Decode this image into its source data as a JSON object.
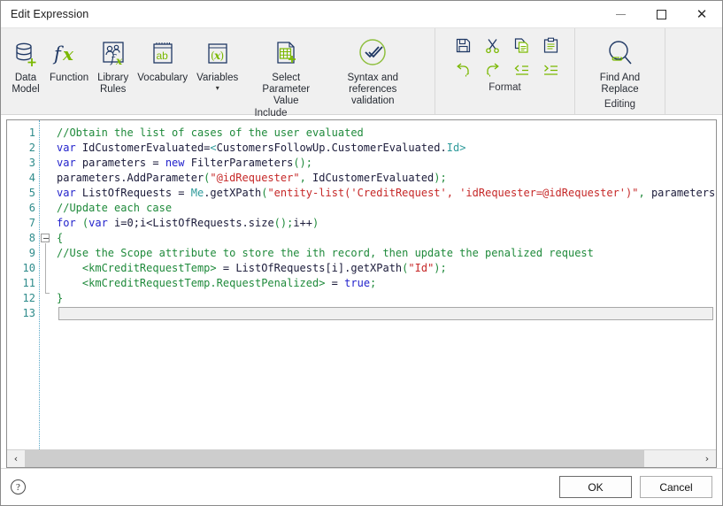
{
  "window": {
    "title": "Edit Expression",
    "controls": {
      "minimize": "–",
      "maximize": "□",
      "close": "✕"
    }
  },
  "ribbon": {
    "groups": [
      {
        "name": "include",
        "label": "Include",
        "items": [
          {
            "id": "data-model",
            "label": "Data\nModel",
            "icon": "database-plus-icon"
          },
          {
            "id": "function",
            "label": "Function",
            "icon": "fx-icon"
          },
          {
            "id": "library-rules",
            "label": "Library\nRules",
            "icon": "people-fx-icon"
          },
          {
            "id": "vocabulary",
            "label": "Vocabulary",
            "icon": "ab-notepad-icon"
          },
          {
            "id": "variables",
            "label": "Variables",
            "icon": "variable-x-icon",
            "caret": "▾"
          },
          {
            "id": "select-parameter",
            "label": "Select Parameter\nValue",
            "icon": "table-plus-icon"
          },
          {
            "id": "syntax-validation",
            "label": "Syntax and references\nvalidation",
            "icon": "check-circle-icon"
          }
        ]
      },
      {
        "name": "format",
        "label": "Format",
        "items": [
          {
            "id": "save",
            "icon": "save-icon"
          },
          {
            "id": "cut",
            "icon": "scissors-icon"
          },
          {
            "id": "copy",
            "icon": "copy-icon"
          },
          {
            "id": "paste",
            "icon": "clipboard-icon"
          },
          {
            "id": "undo",
            "icon": "undo-icon"
          },
          {
            "id": "redo",
            "icon": "redo-icon"
          },
          {
            "id": "outdent",
            "icon": "outdent-icon"
          },
          {
            "id": "indent",
            "icon": "indent-icon"
          }
        ]
      },
      {
        "name": "editing",
        "label": "Editing",
        "items": [
          {
            "id": "find-and-replace",
            "label": "Find And\nReplace",
            "icon": "find-replace-icon"
          }
        ]
      }
    ]
  },
  "editor": {
    "line_numbers": [
      "1",
      "2",
      "3",
      "4",
      "5",
      "6",
      "7",
      "8",
      "9",
      "10",
      "11",
      "12",
      "13"
    ],
    "lines": [
      {
        "n": 1,
        "tokens": [
          {
            "t": "//Obtain the list of cases of the user evaluated",
            "c": "c-com"
          }
        ]
      },
      {
        "n": 2,
        "tokens": [
          {
            "t": "var ",
            "c": "c-kw"
          },
          {
            "t": "IdCustomerEvaluated=",
            "c": "c-plain"
          },
          {
            "t": "<",
            "c": "c-type"
          },
          {
            "t": "CustomersFollowUp.CustomerEvaluated.",
            "c": "c-plain"
          },
          {
            "t": "Id",
            "c": "c-type"
          },
          {
            "t": ">",
            "c": "c-type"
          }
        ]
      },
      {
        "n": 3,
        "tokens": [
          {
            "t": "var ",
            "c": "c-kw"
          },
          {
            "t": "parameters = ",
            "c": "c-plain"
          },
          {
            "t": "new ",
            "c": "c-kw"
          },
          {
            "t": "FilterParameters",
            "c": "c-plain"
          },
          {
            "t": "();",
            "c": "c-punc"
          }
        ]
      },
      {
        "n": 4,
        "tokens": [
          {
            "t": "parameters.AddParameter",
            "c": "c-plain"
          },
          {
            "t": "(",
            "c": "c-punc"
          },
          {
            "t": "\"@idRequester\"",
            "c": "c-str"
          },
          {
            "t": ", ",
            "c": "c-punc"
          },
          {
            "t": "IdCustomerEvaluated",
            "c": "c-plain"
          },
          {
            "t": ");",
            "c": "c-punc"
          }
        ]
      },
      {
        "n": 5,
        "tokens": [
          {
            "t": "var ",
            "c": "c-kw"
          },
          {
            "t": "ListOfRequests = ",
            "c": "c-plain"
          },
          {
            "t": "Me",
            "c": "c-type"
          },
          {
            "t": ".getXPath",
            "c": "c-plain"
          },
          {
            "t": "(",
            "c": "c-punc"
          },
          {
            "t": "\"entity-list('CreditRequest', 'idRequester=@idRequester')\"",
            "c": "c-str"
          },
          {
            "t": ", ",
            "c": "c-punc"
          },
          {
            "t": "parameters",
            "c": "c-plain"
          },
          {
            "t": ");",
            "c": "c-punc"
          }
        ]
      },
      {
        "n": 6,
        "tokens": [
          {
            "t": "//Update each case",
            "c": "c-com"
          }
        ]
      },
      {
        "n": 7,
        "tokens": [
          {
            "t": "for ",
            "c": "c-kw"
          },
          {
            "t": "(",
            "c": "c-punc"
          },
          {
            "t": "var ",
            "c": "c-kw"
          },
          {
            "t": "i=0;i<ListOfRequests.size",
            "c": "c-plain"
          },
          {
            "t": "();",
            "c": "c-punc"
          },
          {
            "t": "i++",
            "c": "c-plain"
          },
          {
            "t": ")",
            "c": "c-punc"
          }
        ]
      },
      {
        "n": 8,
        "tokens": [
          {
            "t": "{",
            "c": "c-punc"
          }
        ]
      },
      {
        "n": 9,
        "tokens": [
          {
            "t": "//Use the Scope attribute to store the ith record, then update the penalized request",
            "c": "c-com"
          }
        ]
      },
      {
        "n": 10,
        "tokens": [
          {
            "t": "    ",
            "c": "c-plain"
          },
          {
            "t": "<kmCreditRequestTemp>",
            "c": "c-tag"
          },
          {
            "t": " = ",
            "c": "c-plain"
          },
          {
            "t": "ListOfRequests[i].getXPath",
            "c": "c-plain"
          },
          {
            "t": "(",
            "c": "c-punc"
          },
          {
            "t": "\"Id\"",
            "c": "c-str"
          },
          {
            "t": ");",
            "c": "c-punc"
          }
        ]
      },
      {
        "n": 11,
        "tokens": [
          {
            "t": "    ",
            "c": "c-plain"
          },
          {
            "t": "<kmCreditRequestTemp.RequestPenalized>",
            "c": "c-tag"
          },
          {
            "t": " = ",
            "c": "c-plain"
          },
          {
            "t": "true",
            "c": "c-kw"
          },
          {
            "t": ";",
            "c": "c-punc"
          }
        ]
      },
      {
        "n": 12,
        "tokens": [
          {
            "t": "}",
            "c": "c-punc"
          }
        ]
      },
      {
        "n": 13,
        "tokens": [],
        "caret": true
      }
    ]
  },
  "scrollbar": {
    "left_arrow": "‹",
    "right_arrow": "›"
  },
  "footer": {
    "help": "?",
    "ok_label": "OK",
    "cancel_label": "Cancel"
  },
  "colors": {
    "accent_green": "#7ab800",
    "icon_navy": "#1f3864",
    "comment": "#1f8a3b",
    "keyword": "#2323cc",
    "string": "#c62828",
    "type": "#2e9a9a",
    "gutter": "#2e8b8b",
    "ribbon_bg": "#f0f0f0"
  }
}
